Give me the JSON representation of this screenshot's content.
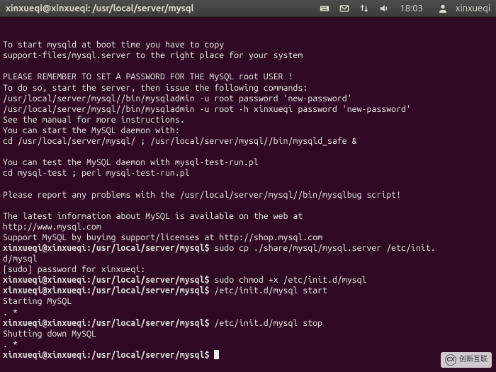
{
  "menubar": {
    "title": "xinxueqi@xinxueqi: /usr/local/server/mysql",
    "clock": "18:03",
    "username": "xinxueqi"
  },
  "icons": {
    "keyboard": "keyboard-icon",
    "mail": "mail-icon",
    "network": "network-updown-icon",
    "volume": "volume-icon",
    "user": "user-icon"
  },
  "terminal": {
    "lines": [
      "",
      "To start mysqld at boot time you have to copy",
      "support-files/mysql.server to the right place for your system",
      "",
      "PLEASE REMEMBER TO SET A PASSWORD FOR THE MySQL root USER !",
      "To do so, start the server, then issue the following commands:",
      "/usr/local/server/mysql//bin/mysqladmin -u root password 'new-password'",
      "/usr/local/server/mysql//bin/mysqladmin -u root -h xinxueqi password 'new-password'",
      "See the manual for more instructions.",
      "You can start the MySQL daemon with:",
      "cd /usr/local/server/mysql/ ; /usr/local/server/mysql//bin/mysqld_safe &",
      "",
      "You can test the MySQL daemon with mysql-test-run.pl",
      "cd mysql-test ; perl mysql-test-run.pl",
      "",
      "Please report any problems with the /usr/local/server/mysql//bin/mysqlbug script!",
      "",
      "The latest information about MySQL is available on the web at",
      "http://www.mysql.com",
      "Support MySQL by buying support/licenses at http://shop.mysql.com"
    ],
    "prompt_lines": [
      {
        "prompt": "xinxueqi@xinxueqi:/usr/local/server/mysql$",
        "cmd": " sudo cp ./share/mysql/mysql.server /etc/init.",
        "wrap": "d/mysql"
      },
      {
        "text": "[sudo] password for xinxueqi:"
      },
      {
        "prompt": "xinxueqi@xinxueqi:/usr/local/server/mysql$",
        "cmd": " sudo chmod +x /etc/init.d/mysql"
      },
      {
        "prompt": "xinxueqi@xinxueqi:/usr/local/server/mysql$",
        "cmd": " /etc/init.d/mysql start"
      },
      {
        "text": "Starting MySQL"
      },
      {
        "text": ". *"
      },
      {
        "prompt": "xinxueqi@xinxueqi:/usr/local/server/mysql$",
        "cmd": " /etc/init.d/mysql stop"
      },
      {
        "text": "Shutting down MySQL"
      },
      {
        "text": ". *"
      },
      {
        "prompt": "xinxueqi@xinxueqi:/usr/local/server/mysql$",
        "cmd": " ",
        "cursor": true
      }
    ]
  },
  "watermark": {
    "logo": "CX",
    "text": "创新互联"
  }
}
